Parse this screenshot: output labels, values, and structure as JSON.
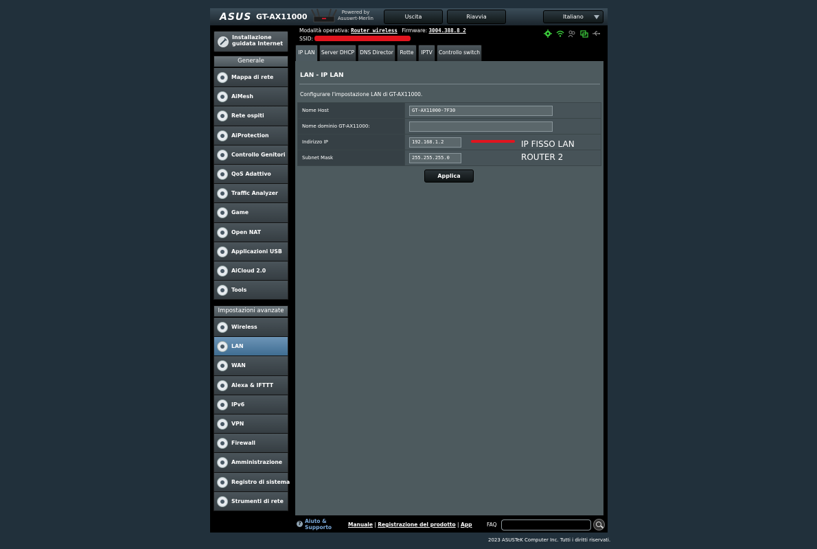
{
  "header": {
    "logo": "ASUS",
    "model": "GT-AX11000",
    "powered_by": "Powered by",
    "powered_name": "Asuswrt-Merlin",
    "logout": "Uscita",
    "reboot": "Riavvia",
    "language": "Italiano"
  },
  "quick_setup": {
    "line1": "Installazione",
    "line2": "guidata Internet"
  },
  "sections": {
    "general": "Generale",
    "advanced": "Impostazioni avanzate"
  },
  "general_menu": [
    {
      "label": "Mappa di rete"
    },
    {
      "label": "AiMesh"
    },
    {
      "label": "Rete ospiti"
    },
    {
      "label": "AiProtection"
    },
    {
      "label": "Controllo Genitori"
    },
    {
      "label": "QoS Adattivo"
    },
    {
      "label": "Traffic Analyzer"
    },
    {
      "label": "Game"
    },
    {
      "label": "Open NAT"
    },
    {
      "label": "Applicazioni USB"
    },
    {
      "label": "AiCloud 2.0"
    },
    {
      "label": "Tools"
    }
  ],
  "advanced_menu": [
    {
      "label": "Wireless"
    },
    {
      "label": "LAN",
      "active": true
    },
    {
      "label": "WAN"
    },
    {
      "label": "Alexa & IFTTT"
    },
    {
      "label": "IPv6"
    },
    {
      "label": "VPN"
    },
    {
      "label": "Firewall"
    },
    {
      "label": "Amministrazione"
    },
    {
      "label": "Registro di sistema"
    },
    {
      "label": "Strumenti di rete"
    }
  ],
  "info": {
    "mode_label": "Modalità operativa:",
    "mode_value": "Router wireless",
    "firmware_label": "Firmware:",
    "firmware_value": "3004.388.8_2",
    "ssid_label": "SSID:"
  },
  "tabs": [
    "IP LAN",
    "Server DHCP",
    "DNS Director",
    "Rotte",
    "IPTV",
    "Controllo switch"
  ],
  "page": {
    "title": "LAN - IP LAN",
    "description": "Configurare l'impostazione LAN di GT-AX11000.",
    "fields": [
      {
        "label": "Nome Host",
        "value": "GT-AX11000-7F30"
      },
      {
        "label": "Nome dominio GT-AX11000:",
        "value": ""
      },
      {
        "label": "Indirizzo IP",
        "value": "192.168.1.2"
      },
      {
        "label": "Subnet Mask",
        "value": "255.255.255.0"
      }
    ],
    "apply": "Applica",
    "annotation_line1": "IP FISSO LAN",
    "annotation_line2": "ROUTER 2"
  },
  "footer": {
    "help_line1": "Aiuto &",
    "help_line2": "Supporto",
    "manual": "Manuale",
    "register": "Registrazione del prodotto",
    "app": "App",
    "faq": "FAQ"
  },
  "copyright": "2023 ASUSTeK Computer Inc. Tutti i diritti riservati.",
  "colors": {
    "accent_active": "#4f7fa6",
    "content_bg": "#4d5a5e",
    "annotation_red": "#e2141e"
  }
}
